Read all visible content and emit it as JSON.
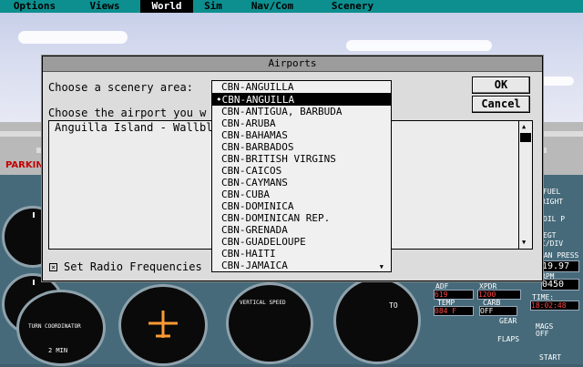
{
  "menu": [
    {
      "label": "Options",
      "active": false
    },
    {
      "label": "Views",
      "active": false
    },
    {
      "label": "World",
      "active": true
    },
    {
      "label": "Sim",
      "active": false
    },
    {
      "label": "Nav/Com",
      "active": false
    },
    {
      "label": "Scenery",
      "active": false
    }
  ],
  "background": {
    "parking_sign": "PARKIN"
  },
  "dialog": {
    "title": "Airports",
    "scenery_label": "Choose a scenery area:",
    "airport_label": "Choose the airport you w",
    "ok_label": "OK",
    "cancel_label": "Cancel",
    "airport_list": [
      "Anguilla Island - Wallblak"
    ],
    "radio_label": "Set Radio Frequencies",
    "radio_checked": true,
    "scenery_value": "CBN-ANGUILLA",
    "scenery_options": [
      "•CBN-ANGUILLA",
      "CBN-ANTIGUA, BARBUDA",
      "CBN-ARUBA",
      "CBN-BAHAMAS",
      "CBN-BARBADOS",
      "CBN-BRITISH VIRGINS",
      "CBN-CAICOS",
      "CBN-CAYMANS",
      "CBN-CUBA",
      "CBN-DOMINICA",
      "CBN-DOMINICAN REP.",
      "CBN-GRENADA",
      "CBN-GUADELOUPE",
      "CBN-HAITI",
      "CBN-JAMAICA"
    ]
  },
  "instruments": {
    "fuel": "FUEL",
    "right": "RIGHT",
    "oil_p": "OIL P",
    "egt": "EGT",
    "c_div": "C/DIV",
    "man_press_label": "MAN PRESS",
    "man_press": "19.97",
    "rpm_label": "RPM",
    "rpm": "0450",
    "adf_label": "ADF",
    "adf": "619",
    "xpdr_label": "XPDR",
    "xpdr": "1200",
    "temp_label": "TEMP",
    "temp": "084 F",
    "carb_label": "CARB",
    "carb": "OFF",
    "time_label": "TIME:",
    "time": "18:02:48",
    "gear_label": "GEAR",
    "flaps_label": "FLAPS",
    "mags_label": "MAGS",
    "mags": "OFF",
    "start": "START",
    "vertical_speed": "VERTICAL SPEED",
    "turn_coordinator": "TURN COORDINATOR",
    "min2": "2 MIN",
    "to_flag": "TO"
  },
  "colors": {
    "menubar": "#0d8f8f",
    "selection": "#000000",
    "dialog_bg": "#dcdcdc"
  }
}
